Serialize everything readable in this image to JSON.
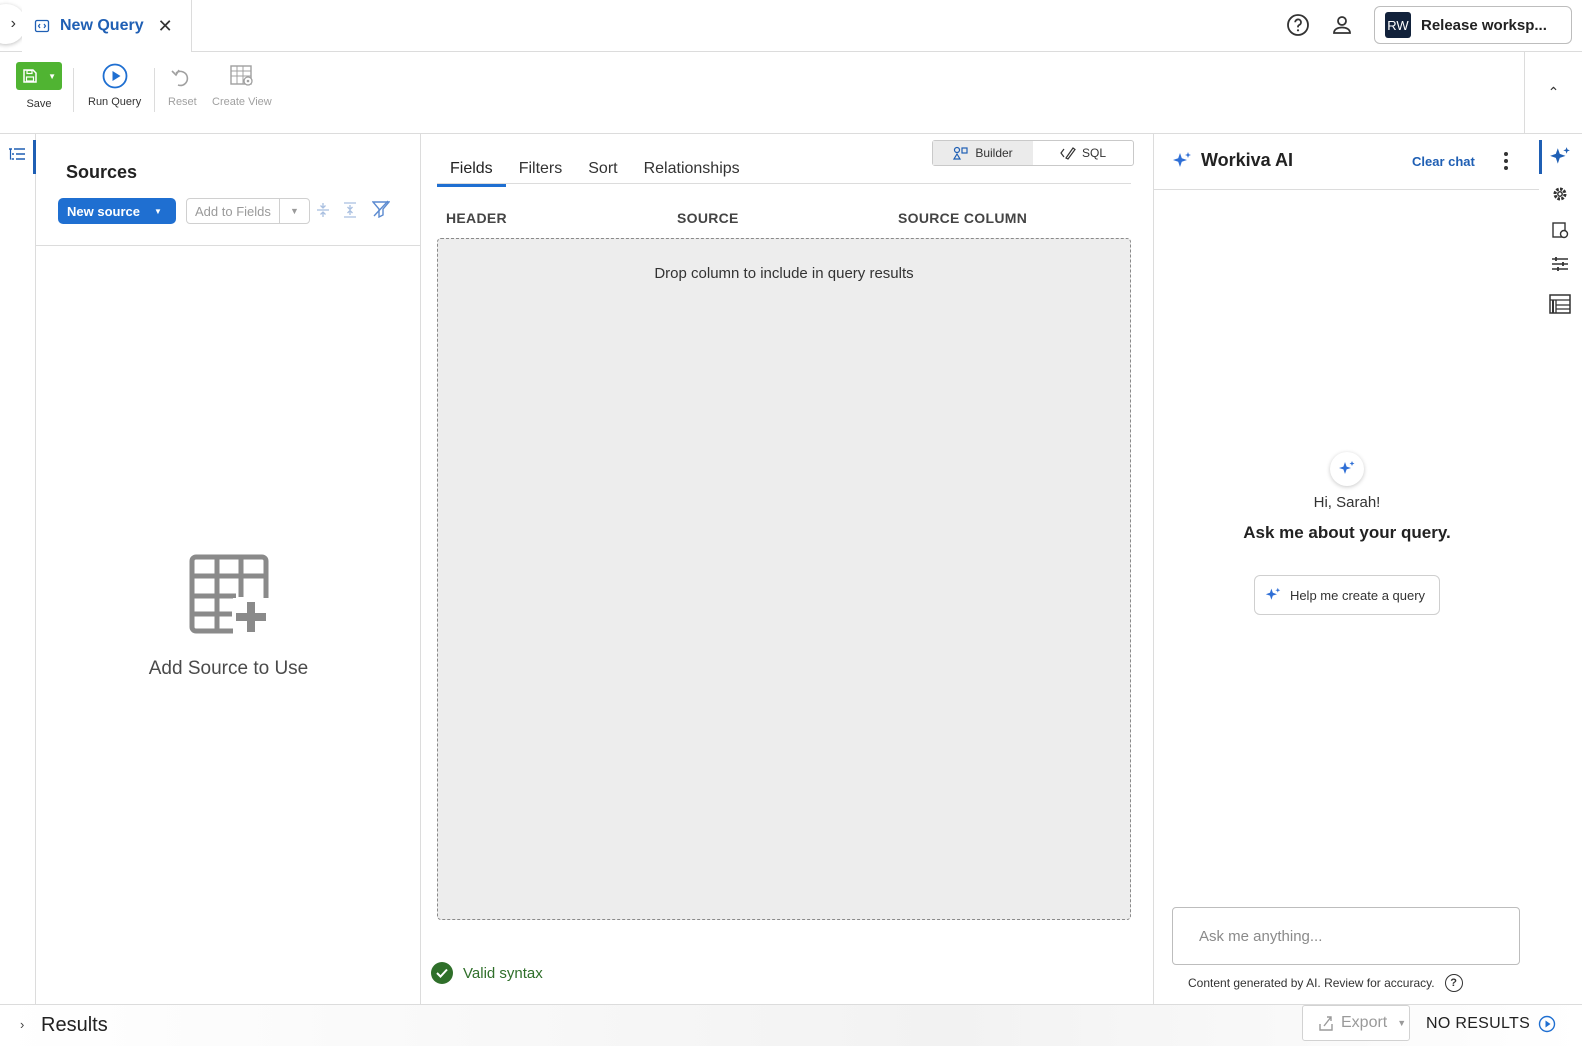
{
  "tab": {
    "title": "New Query"
  },
  "topbar": {
    "workspace_initials": "RW",
    "workspace_label": "Release worksp..."
  },
  "toolbar": {
    "save_label": "Save",
    "run_label": "Run Query",
    "reset_label": "Reset",
    "create_view_label": "Create View"
  },
  "sources": {
    "title": "Sources",
    "new_source_label": "New source",
    "add_to_fields_label": "Add to Fields",
    "empty_label": "Add Source to Use"
  },
  "builder": {
    "tabs": [
      "Fields",
      "Filters",
      "Sort",
      "Relationships"
    ],
    "active_tab": "Fields",
    "mode_builder": "Builder",
    "mode_sql": "SQL",
    "columns": [
      "HEADER",
      "SOURCE",
      "SOURCE COLUMN"
    ],
    "drop_message": "Drop column to include in query results",
    "syntax_status": "Valid syntax"
  },
  "ai": {
    "title": "Workiva AI",
    "clear_label": "Clear chat",
    "greeting": "Hi, Sarah!",
    "prompt": "Ask me about your query.",
    "help_button": "Help me create a query",
    "input_placeholder": "Ask me anything...",
    "disclaimer": "Content generated by AI. Review for accuracy."
  },
  "results": {
    "label": "Results",
    "export_label": "Export",
    "status": "NO RESULTS"
  },
  "colors": {
    "accent_blue": "#1f6fd1",
    "link_blue": "#1f5fb4",
    "save_green": "#50b432",
    "valid_green": "#2f6f2a",
    "ai_sparkle": "#2f6fd6"
  },
  "icons": [
    "query-icon",
    "close-icon",
    "help-icon",
    "user-icon",
    "save-icon",
    "play-icon",
    "undo-icon",
    "create-view-icon",
    "outline-icon",
    "table-add-icon",
    "sparkle-icon",
    "gear-icon",
    "settings-doc-icon",
    "sliders-icon",
    "table-layout-icon",
    "check-icon",
    "export-icon",
    "chevron-right-icon",
    "chevron-up-icon",
    "kebab-icon"
  ]
}
